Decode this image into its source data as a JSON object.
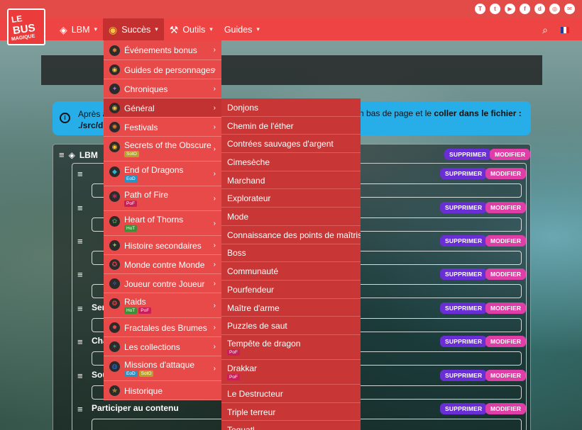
{
  "social": [
    "twitch",
    "twitter",
    "youtube",
    "facebook",
    "discord",
    "instagram",
    "email"
  ],
  "social_glyphs": [
    "T",
    "t",
    "▶",
    "f",
    "d",
    "◎",
    "✉"
  ],
  "logo": {
    "line1": "LE",
    "line2": "BUS",
    "line3": "MAGIQUE"
  },
  "nav": {
    "items": [
      {
        "label": "LBM",
        "icon": "lbm-icon"
      },
      {
        "label": "Succès",
        "icon": "achievement-icon"
      },
      {
        "label": "Outils",
        "icon": "tools-icon"
      },
      {
        "label": "Guides",
        "icon": ""
      }
    ]
  },
  "info": {
    "left_line1": "Après a",
    "left_line2": "./src/d",
    "right_text": "n bas de page et le ",
    "right_bold": "coller dans le fichier :"
  },
  "panel": {
    "title": "LBM",
    "delete_label": "SUPPRIMER",
    "modify_label": "MODIFIER",
    "row_labels": [
      "Ser",
      "Cha",
      "Sou",
      "Participer au contenu"
    ]
  },
  "menu1": [
    {
      "label": "Événements bonus",
      "tags": []
    },
    {
      "label": "Guides de personnages",
      "tags": []
    },
    {
      "label": "Chroniques",
      "tags": []
    },
    {
      "label": "Général",
      "tags": []
    },
    {
      "label": "Festivals",
      "tags": []
    },
    {
      "label": "Secrets of the Obscure",
      "tags": [
        "SotO"
      ]
    },
    {
      "label": "End of Dragons",
      "tags": [
        "EoD"
      ]
    },
    {
      "label": "Path of Fire",
      "tags": [
        "PoF"
      ]
    },
    {
      "label": "Heart of Thorns",
      "tags": [
        "HoT"
      ]
    },
    {
      "label": "Histoire secondaires",
      "tags": []
    },
    {
      "label": "Monde contre Monde",
      "tags": []
    },
    {
      "label": "Joueur contre Joueur",
      "tags": []
    },
    {
      "label": "Raids",
      "tags": [
        "HoT",
        "PoF"
      ]
    },
    {
      "label": "Fractales des Brumes",
      "tags": []
    },
    {
      "label": "Les collections",
      "tags": []
    },
    {
      "label": "Missions d'attaque",
      "tags": [
        "EoD",
        "SotO"
      ]
    },
    {
      "label": "Historique",
      "tags": []
    }
  ],
  "menu2": [
    {
      "label": "Donjons",
      "tags": []
    },
    {
      "label": "Chemin de l'éther",
      "tags": []
    },
    {
      "label": "Contrées sauvages d'argent",
      "tags": []
    },
    {
      "label": "Cimesèche",
      "tags": []
    },
    {
      "label": "Marchand",
      "tags": []
    },
    {
      "label": "Explorateur",
      "tags": []
    },
    {
      "label": "Mode",
      "tags": []
    },
    {
      "label": "Connaissance des points de maîtrise",
      "tags": []
    },
    {
      "label": "Boss",
      "tags": []
    },
    {
      "label": "Communauté",
      "tags": []
    },
    {
      "label": "Pourfendeur",
      "tags": []
    },
    {
      "label": "Maître d'arme",
      "tags": []
    },
    {
      "label": "Puzzles de saut",
      "tags": []
    },
    {
      "label": "Tempête de dragon",
      "tags": [
        "PoF"
      ]
    },
    {
      "label": "Drakkar",
      "tags": [
        "PoF"
      ]
    },
    {
      "label": "Le Destructeur",
      "tags": []
    },
    {
      "label": "Triple terreur",
      "tags": []
    },
    {
      "label": "Tequatl",
      "tags": []
    }
  ],
  "colors": {
    "accent": "#ee4444",
    "tag_hot": "#3f8f3a",
    "tag_pof": "#c91f58",
    "tag_eod": "#2a93c4",
    "tag_soto": "#b7a12a"
  }
}
